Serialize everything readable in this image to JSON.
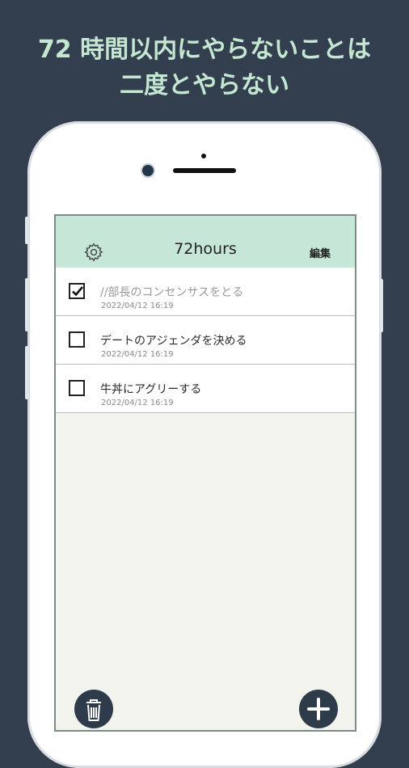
{
  "headline": {
    "line1": "72 時間以内にやらないことは",
    "line2": "二度とやらない"
  },
  "appbar": {
    "title": "72hours",
    "edit_label": "編集",
    "settings_icon": "gear-icon"
  },
  "tasks": [
    {
      "text": "//部長のコンセンサスをとる",
      "timestamp": "2022/04/12 16:19",
      "checked": true
    },
    {
      "text": "デートのアジェンダを決める",
      "timestamp": "2022/04/12 16:19",
      "checked": false
    },
    {
      "text": "牛丼にアグリーする",
      "timestamp": "2022/04/12 16:19",
      "checked": false
    }
  ],
  "fabs": {
    "delete_icon": "trash-icon",
    "add_icon": "plus-icon"
  },
  "colors": {
    "background": "#333f4e",
    "headline": "#c4e7d2",
    "appbar": "#c6e7d7",
    "fab": "#2e3b4b"
  }
}
